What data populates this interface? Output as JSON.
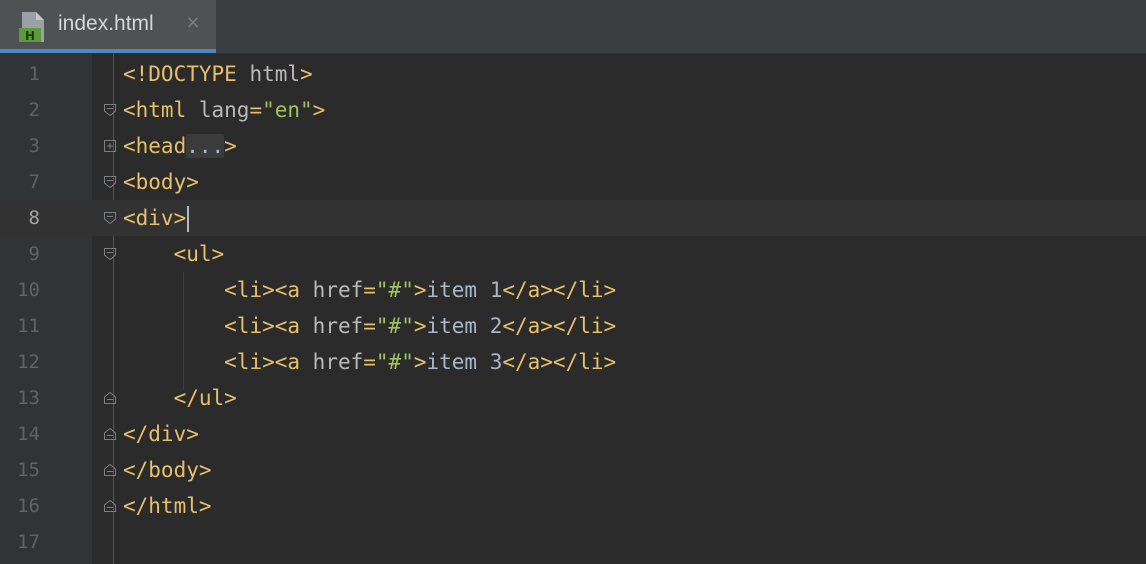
{
  "tab": {
    "title": "index.html",
    "icon": "html-file-icon",
    "icon_badge": "H",
    "close_glyph": "×"
  },
  "colors": {
    "editor_bg": "#2b2b2b",
    "tag": "#e8bf6a",
    "attribute": "#bababa",
    "string": "#a5c261",
    "text": "#a9b7c6",
    "line_number": "#606366",
    "accent": "#4a88c7"
  },
  "lines": [
    {
      "num": "1",
      "tokens": [
        {
          "t": "tag",
          "v": "<!DOCTYPE "
        },
        {
          "t": "attr",
          "v": "html"
        },
        {
          "t": "tag",
          "v": ">"
        }
      ]
    },
    {
      "num": "2",
      "fold": "open",
      "tokens": [
        {
          "t": "tag",
          "v": "<html "
        },
        {
          "t": "attr",
          "v": "lang"
        },
        {
          "t": "tag",
          "v": "="
        },
        {
          "t": "str",
          "v": "\"en\""
        },
        {
          "t": "tag",
          "v": ">"
        }
      ]
    },
    {
      "num": "3",
      "fold": "collapsed",
      "tokens": [
        {
          "t": "tag",
          "v": "<head"
        },
        {
          "t": "ellipsis",
          "v": "..."
        },
        {
          "t": "tag",
          "v": ">"
        }
      ]
    },
    {
      "num": "7",
      "fold": "open",
      "tokens": [
        {
          "t": "tag",
          "v": "<body>"
        }
      ]
    },
    {
      "num": "8",
      "fold": "open",
      "current": true,
      "caret": true,
      "tokens": [
        {
          "t": "tag",
          "v": "<div>"
        }
      ]
    },
    {
      "num": "9",
      "fold": "open",
      "tokens": [
        {
          "t": "txt",
          "v": "    "
        },
        {
          "t": "tag",
          "v": "<ul>"
        }
      ]
    },
    {
      "num": "10",
      "tokens": [
        {
          "t": "txt",
          "v": "        "
        },
        {
          "t": "tag",
          "v": "<li><a "
        },
        {
          "t": "attr",
          "v": "href"
        },
        {
          "t": "tag",
          "v": "="
        },
        {
          "t": "str",
          "v": "\"#\""
        },
        {
          "t": "tag",
          "v": ">"
        },
        {
          "t": "txt",
          "v": "item 1"
        },
        {
          "t": "tag",
          "v": "</a></li>"
        }
      ]
    },
    {
      "num": "11",
      "tokens": [
        {
          "t": "txt",
          "v": "        "
        },
        {
          "t": "tag",
          "v": "<li><a "
        },
        {
          "t": "attr",
          "v": "href"
        },
        {
          "t": "tag",
          "v": "="
        },
        {
          "t": "str",
          "v": "\"#\""
        },
        {
          "t": "tag",
          "v": ">"
        },
        {
          "t": "txt",
          "v": "item 2"
        },
        {
          "t": "tag",
          "v": "</a></li>"
        }
      ]
    },
    {
      "num": "12",
      "tokens": [
        {
          "t": "txt",
          "v": "        "
        },
        {
          "t": "tag",
          "v": "<li><a "
        },
        {
          "t": "attr",
          "v": "href"
        },
        {
          "t": "tag",
          "v": "="
        },
        {
          "t": "str",
          "v": "\"#\""
        },
        {
          "t": "tag",
          "v": ">"
        },
        {
          "t": "txt",
          "v": "item 3"
        },
        {
          "t": "tag",
          "v": "</a></li>"
        }
      ]
    },
    {
      "num": "13",
      "fold": "end",
      "tokens": [
        {
          "t": "txt",
          "v": "    "
        },
        {
          "t": "tag",
          "v": "</ul>"
        }
      ]
    },
    {
      "num": "14",
      "fold": "end",
      "tokens": [
        {
          "t": "tag",
          "v": "</div>"
        }
      ]
    },
    {
      "num": "15",
      "fold": "end",
      "tokens": [
        {
          "t": "tag",
          "v": "</body>"
        }
      ]
    },
    {
      "num": "16",
      "fold": "end",
      "tokens": [
        {
          "t": "tag",
          "v": "</html>"
        }
      ]
    },
    {
      "num": "17",
      "tokens": []
    }
  ]
}
